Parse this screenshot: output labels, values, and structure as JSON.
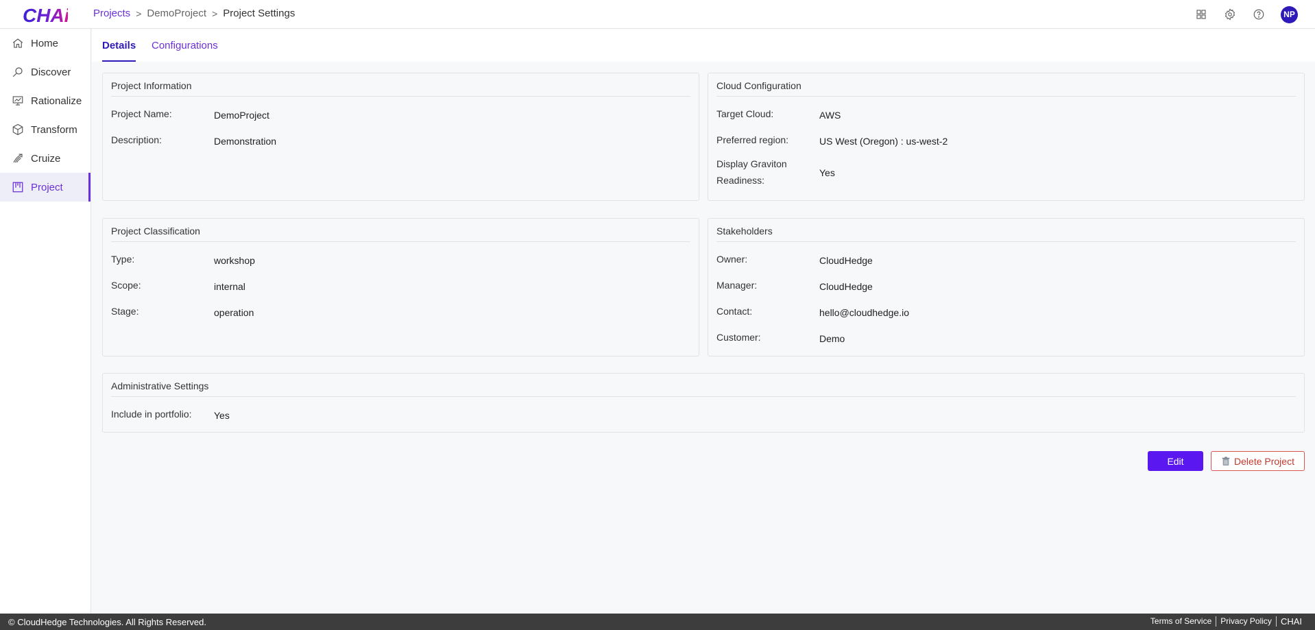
{
  "app": {
    "logo_text": "CHAi"
  },
  "breadcrumb": {
    "projects": "Projects",
    "project": "DemoProject",
    "current": "Project Settings",
    "sep": ">"
  },
  "user": {
    "initials": "NP"
  },
  "sidebar": {
    "items": [
      {
        "label": "Home",
        "icon": "home-icon"
      },
      {
        "label": "Discover",
        "icon": "discover-icon"
      },
      {
        "label": "Rationalize",
        "icon": "rationalize-icon"
      },
      {
        "label": "Transform",
        "icon": "transform-icon"
      },
      {
        "label": "Cruize",
        "icon": "cruize-icon"
      },
      {
        "label": "Project",
        "icon": "project-icon",
        "active": true
      }
    ]
  },
  "tabs": {
    "details": "Details",
    "configurations": "Configurations",
    "active": "Details"
  },
  "project_info": {
    "title": "Project Information",
    "name_label": "Project Name:",
    "name_value": "DemoProject",
    "desc_label": "Description:",
    "desc_value": "Demonstration"
  },
  "cloud_config": {
    "title": "Cloud Configuration",
    "target_label": "Target Cloud:",
    "target_value": "AWS",
    "region_label": "Preferred region:",
    "region_value": "US West (Oregon) : us-west-2",
    "graviton_label_1": "Display Graviton",
    "graviton_label_2": "Readiness:",
    "graviton_value": "Yes"
  },
  "classification": {
    "title": "Project Classification",
    "type_label": "Type:",
    "type_value": "workshop",
    "scope_label": "Scope:",
    "scope_value": "internal",
    "stage_label": "Stage:",
    "stage_value": "operation"
  },
  "stakeholders": {
    "title": "Stakeholders",
    "owner_label": "Owner:",
    "owner_value": "CloudHedge",
    "manager_label": "Manager:",
    "manager_value": "CloudHedge",
    "contact_label": "Contact:",
    "contact_value": "hello@cloudhedge.io",
    "customer_label": "Customer:",
    "customer_value": "Demo"
  },
  "admin": {
    "title": "Administrative Settings",
    "portfolio_label": "Include in portfolio:",
    "portfolio_value": "Yes"
  },
  "actions": {
    "edit": "Edit",
    "delete": "Delete Project"
  },
  "footer": {
    "copyright": "© CloudHedge Technologies. All Rights Reserved.",
    "terms": "Terms of Service",
    "privacy": "Privacy Policy",
    "brand": "CHAI"
  },
  "colors": {
    "accent": "#6b30d9",
    "primary_button": "#5a17f0",
    "danger": "#d9534f",
    "avatar": "#2d1ab8"
  }
}
